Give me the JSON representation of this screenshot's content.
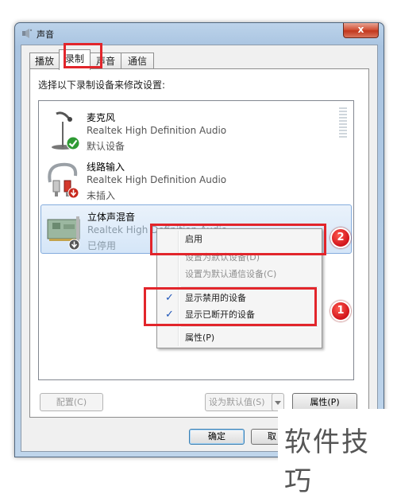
{
  "window": {
    "title": "声音",
    "close_glyph": "x"
  },
  "tabs": [
    {
      "label": "播放"
    },
    {
      "label": "录制"
    },
    {
      "label": "声音"
    },
    {
      "label": "通信"
    }
  ],
  "instruction": "选择以下录制设备来修改设置:",
  "devices": [
    {
      "name": "麦克风",
      "driver": "Realtek High Definition Audio",
      "status": "默认设备",
      "icon": "microphone-icon",
      "badge": "default-check-badge"
    },
    {
      "name": "线路输入",
      "driver": "Realtek High Definition Audio",
      "status": "未插入",
      "icon": "line-in-cable-icon",
      "badge": "unplugged-badge"
    },
    {
      "name": "立体声混音",
      "driver": "Realtek High Definition Audio",
      "status": "已停用",
      "icon": "sound-card-icon",
      "badge": "disabled-badge"
    }
  ],
  "context_menu": {
    "items": [
      {
        "label": "启用",
        "enabled": true,
        "checked": false
      },
      {
        "label": "设置为默认设备(D)",
        "enabled": false,
        "checked": false
      },
      {
        "label": "设置为默认通信设备(C)",
        "enabled": false,
        "checked": false
      },
      {
        "label": "显示禁用的设备",
        "enabled": true,
        "checked": true
      },
      {
        "label": "显示已断开的设备",
        "enabled": true,
        "checked": true
      },
      {
        "label": "属性(P)",
        "enabled": true,
        "checked": false
      }
    ],
    "check_glyph": "✓"
  },
  "buttons": {
    "configure": "配置(C)",
    "set_default": "设为默认值(S)",
    "properties": "属性(P)",
    "ok": "确定",
    "cancel": "取"
  },
  "annotations": {
    "marker_1": "1",
    "marker_2": "2"
  },
  "watermark": "软件技巧",
  "colors": {
    "highlight": "#e2252b",
    "selection": "#d5e6f8",
    "check": "#1d55b8"
  }
}
